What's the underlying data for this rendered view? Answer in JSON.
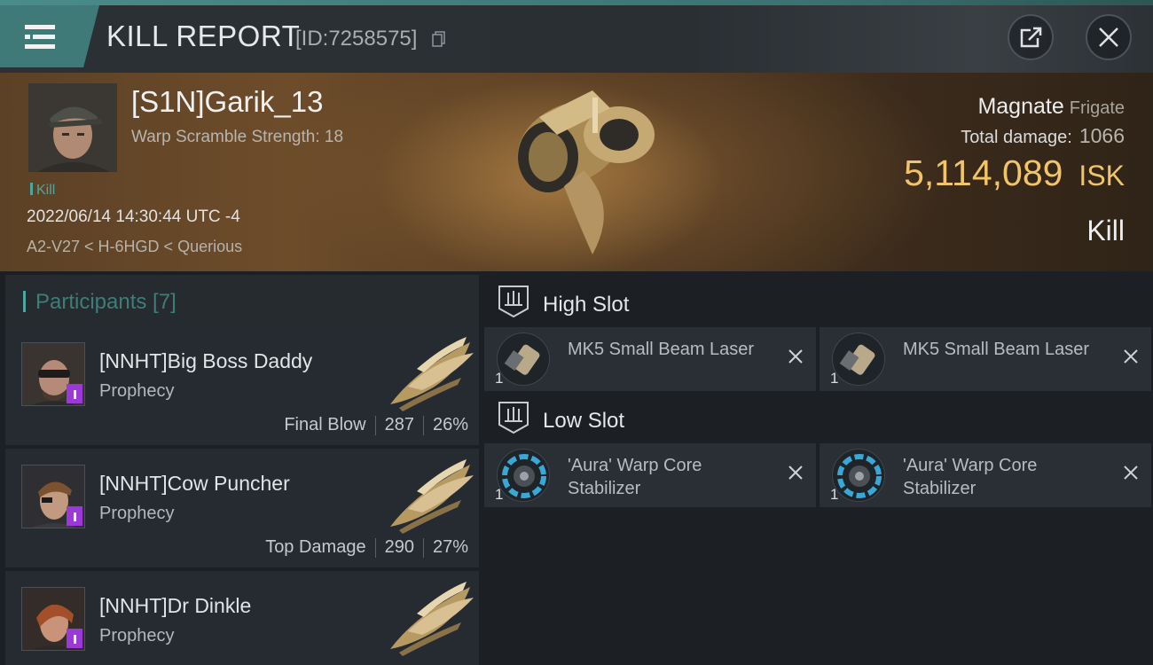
{
  "header": {
    "title": "KILL REPORT",
    "report_id": "[ID:7258575]"
  },
  "victim": {
    "name": "[S1N]Garik_13",
    "warp_scramble": "Warp Scramble Strength: 18",
    "tag": "Kill",
    "timestamp": "2022/06/14 14:30:44 UTC -4",
    "location": "A2-V27 < H-6HGD < Querious",
    "ship_name": "Magnate",
    "ship_class": "Frigate",
    "damage_label": "Total damage:",
    "damage_value": "1066",
    "isk_value": "5,114,089",
    "isk_unit": "ISK",
    "result": "Kill"
  },
  "participants": {
    "title": "Participants [7]",
    "items": [
      {
        "name": "[NNHT]Big Boss Daddy",
        "ship": "Prophecy",
        "role": "Final Blow",
        "damage": "287",
        "percent": "26%"
      },
      {
        "name": "[NNHT]Cow Puncher",
        "ship": "Prophecy",
        "role": "Top Damage",
        "damage": "290",
        "percent": "27%"
      },
      {
        "name": "[NNHT]Dr Dinkle",
        "ship": "Prophecy"
      }
    ]
  },
  "fitting": {
    "high_slot": {
      "title": "High Slot",
      "modules": [
        {
          "qty": "1",
          "name": "MK5 Small Beam Laser",
          "icon": "beam-laser-icon"
        },
        {
          "qty": "1",
          "name": "MK5 Small Beam Laser",
          "icon": "beam-laser-icon"
        }
      ]
    },
    "low_slot": {
      "title": "Low Slot",
      "modules": [
        {
          "qty": "1",
          "name": "'Aura' Warp Core Stabilizer",
          "icon": "warp-core-stabilizer-icon"
        },
        {
          "qty": "1",
          "name": "'Aura' Warp Core Stabilizer",
          "icon": "warp-core-stabilizer-icon"
        }
      ]
    }
  },
  "colors": {
    "accent": "#3f7a78",
    "isk": "#f2c46a",
    "badge": "#9b39d8"
  }
}
